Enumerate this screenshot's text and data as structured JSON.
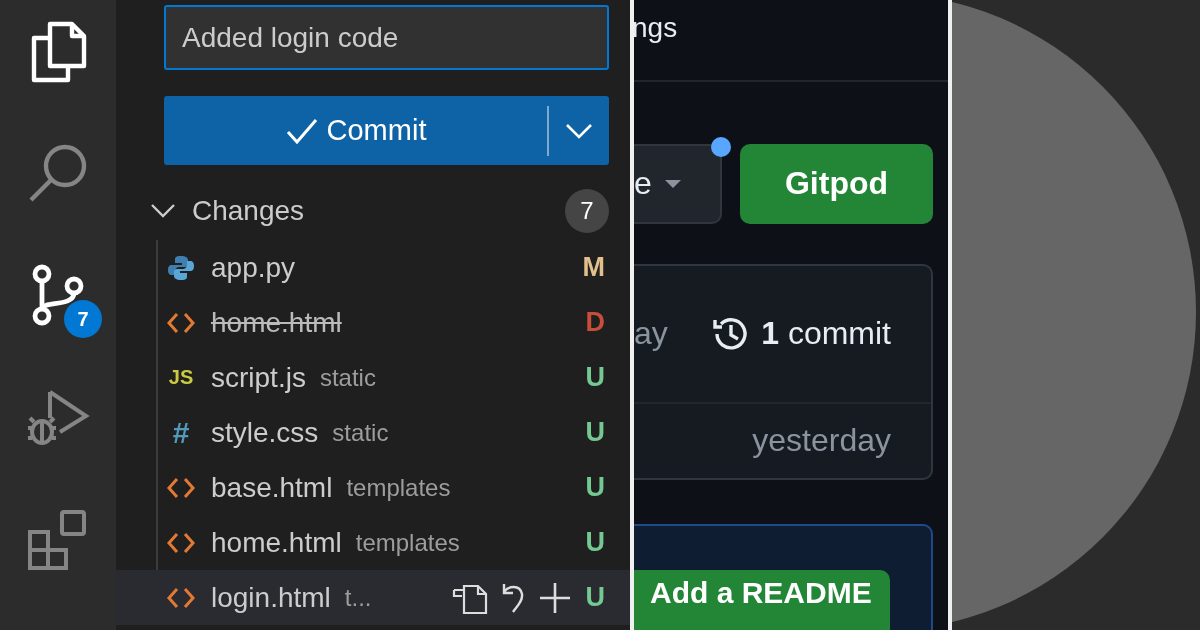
{
  "activity_bar": {
    "items": [
      {
        "kind": "explorer",
        "active": true
      },
      {
        "kind": "search",
        "active": false
      },
      {
        "kind": "source-control",
        "active": true,
        "badge": "7"
      },
      {
        "kind": "run-debug",
        "active": false
      },
      {
        "kind": "extensions",
        "active": false
      }
    ]
  },
  "commit_message": {
    "value": "Added login code"
  },
  "commit_button": {
    "label": "Commit"
  },
  "changes": {
    "label": "Changes",
    "count": "7",
    "expanded": true,
    "files": [
      {
        "name": "app.py",
        "kind": "python",
        "status": "M",
        "color": "#e2c08d",
        "deleted": false,
        "hovered": false
      },
      {
        "name": "home.html",
        "kind": "html",
        "status": "D",
        "color": "#c74e39",
        "deleted": true,
        "hovered": false
      },
      {
        "name": "script.js",
        "folder": "static",
        "kind": "js",
        "icon_glyph": "JS",
        "status": "U",
        "color": "#73c991",
        "deleted": false,
        "hovered": false
      },
      {
        "name": "style.css",
        "folder": "static",
        "kind": "css",
        "icon_glyph": "#",
        "status": "U",
        "color": "#73c991",
        "deleted": false,
        "hovered": false
      },
      {
        "name": "base.html",
        "folder": "templates",
        "kind": "html",
        "status": "U",
        "color": "#73c991",
        "deleted": false,
        "hovered": false
      },
      {
        "name": "home.html",
        "folder": "templates",
        "kind": "html",
        "status": "U",
        "color": "#73c991",
        "deleted": false,
        "hovered": false
      },
      {
        "name": "login.html",
        "folder": "t...",
        "kind": "html",
        "status": "U",
        "color": "#73c991",
        "deleted": false,
        "hovered": true
      }
    ]
  },
  "github": {
    "tab_fragment": "ngs",
    "dropdown": {
      "label": "e"
    },
    "notification_dot": true,
    "gitpod_button": "Gitpod",
    "card": {
      "fragment": "ay",
      "commits": "**1** commit",
      "time": "yesterday"
    },
    "readme_button": "Add a README"
  }
}
